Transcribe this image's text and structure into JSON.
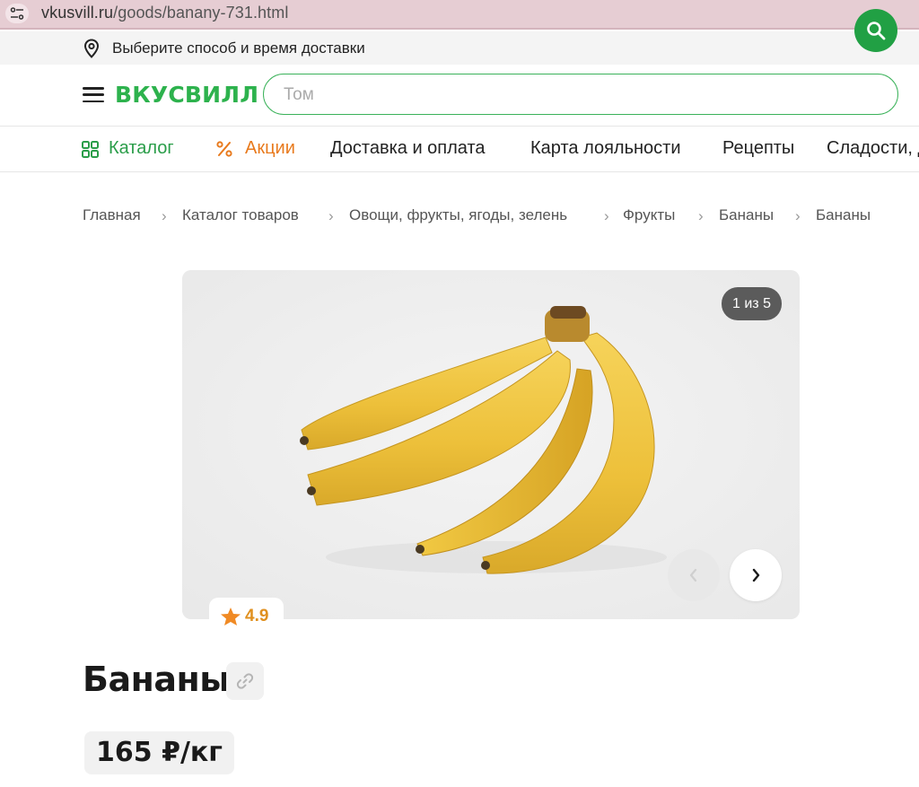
{
  "browser": {
    "url_host": "vkusvill.ru",
    "url_path": "/goods/banany-731.html",
    "site_info_icon": "site-settings-icon"
  },
  "delivery": {
    "icon": "location-pin-icon",
    "text": "Выберите способ и время доставки"
  },
  "header": {
    "menu_icon": "hamburger-menu-icon",
    "logo_text": "ВКУСВИЛЛ",
    "search_placeholder": "Том",
    "search_icon": "search-icon",
    "brand_color": "#21a044"
  },
  "nav": {
    "items": [
      {
        "label": "Каталог",
        "icon": "grid-icon"
      },
      {
        "label": "Акции",
        "icon": "percent-icon"
      },
      {
        "label": "Доставка и оплата"
      },
      {
        "label": "Карта лояльности"
      },
      {
        "label": "Рецепты"
      },
      {
        "label": "Сладости, д"
      }
    ]
  },
  "breadcrumbs": [
    "Главная",
    "Каталог товаров",
    "Овощи, фрукты, ягоды, зелень",
    "Фрукты",
    "Бананы",
    "Бананы"
  ],
  "gallery": {
    "counter": "1 из 5",
    "prev_icon": "chevron-left-icon",
    "next_icon": "chevron-right-icon",
    "image": "banana-bunch-photo"
  },
  "rating": {
    "icon": "star-icon",
    "value": "4.9",
    "color": "#e0901f"
  },
  "product": {
    "title": "Бананы",
    "link_icon": "link-icon",
    "price": "165 ₽/кг"
  }
}
